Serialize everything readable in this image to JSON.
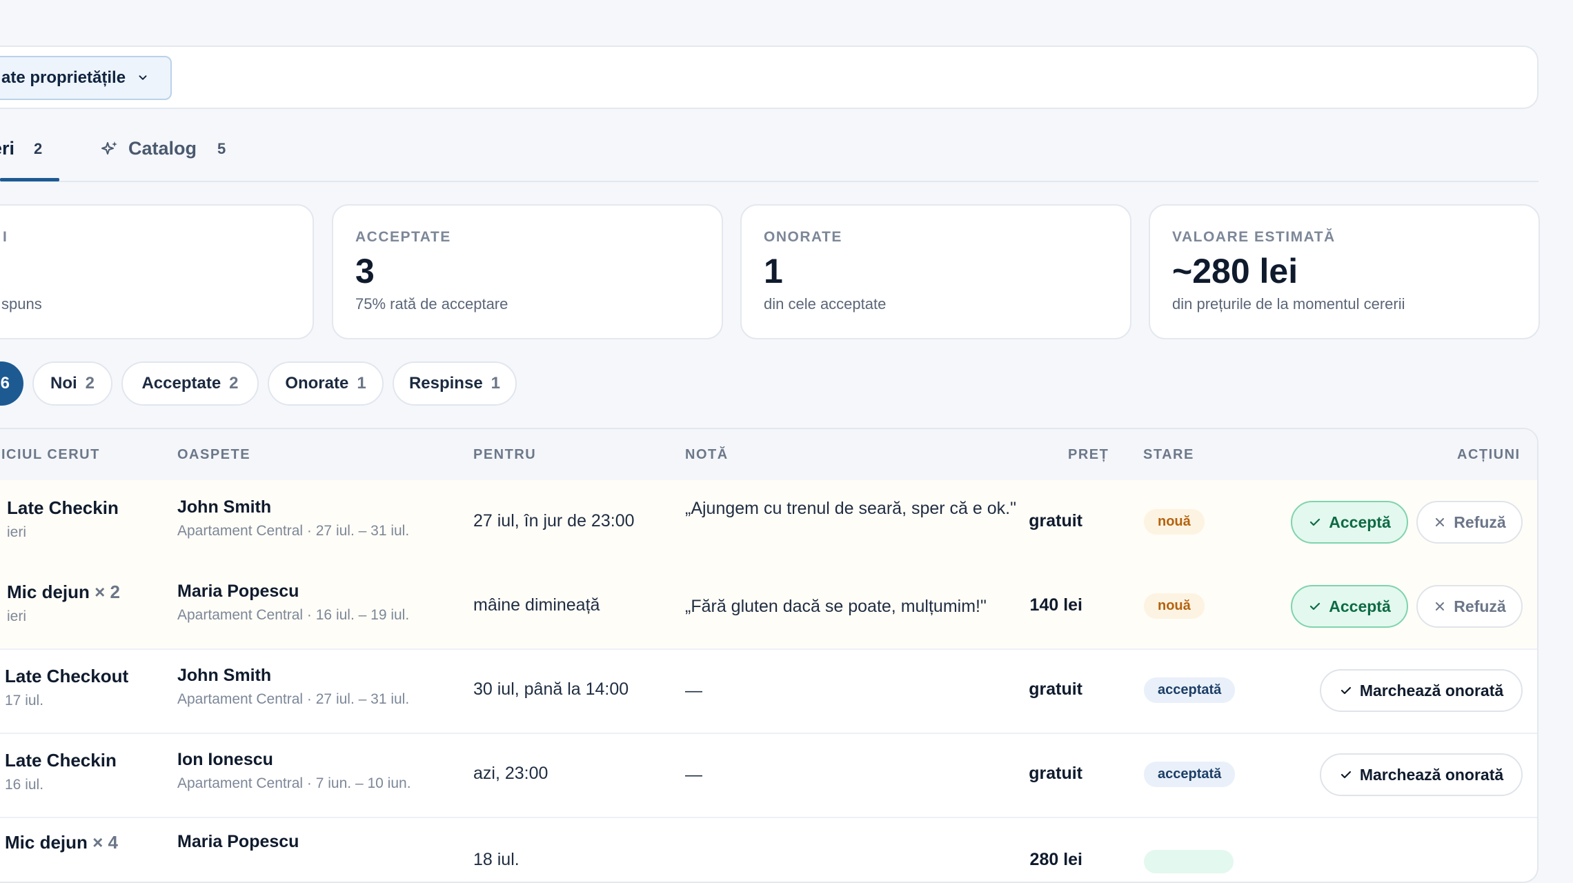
{
  "filter": {
    "property_select": "ate proprietățile"
  },
  "tabs": [
    {
      "label": "eri",
      "count": "2"
    },
    {
      "label": "Catalog",
      "count": "5"
    }
  ],
  "stats": [
    {
      "label": "I",
      "value": "",
      "sub": "spuns"
    },
    {
      "label": "ACCEPTATE",
      "value": "3",
      "sub": "75% rată de acceptare"
    },
    {
      "label": "ONORATE",
      "value": "1",
      "sub": "din cele acceptate"
    },
    {
      "label": "VALOARE ESTIMATĂ",
      "value": "~280 lei",
      "sub": "din prețurile de la momentul cererii"
    }
  ],
  "chips": {
    "active": "6",
    "items": [
      {
        "label": "Noi",
        "count": "2"
      },
      {
        "label": "Acceptate",
        "count": "2"
      },
      {
        "label": "Onorate",
        "count": "1"
      },
      {
        "label": "Respinse",
        "count": "1"
      }
    ]
  },
  "table": {
    "headers": {
      "service": "ICIUL CERUT",
      "guest": "OASPETE",
      "for": "PENTRU",
      "note": "NOTĂ",
      "price": "PREȚ",
      "status": "STARE",
      "actions": "ACȚIUNI"
    },
    "rows": [
      {
        "service": "Late Checkin",
        "qty": "",
        "service_sub": "ieri",
        "guest": "John Smith",
        "guest_sub": "Apartament Central · 27 iul. – 31 iul.",
        "for": "27 iul, în jur de 23:00",
        "note": "„Ajungem cu trenul de seară, sper că e ok.\"",
        "price": "gratuit",
        "status": "nouă"
      },
      {
        "service": "Mic dejun",
        "qty": "× 2",
        "service_sub": "ieri",
        "guest": "Maria Popescu",
        "guest_sub": "Apartament Central · 16 iul. – 19 iul.",
        "for": "mâine dimineață",
        "note": "„Fără gluten dacă se poate, mulțumim!\"",
        "price": "140 lei",
        "status": "nouă"
      },
      {
        "service": "Late Checkout",
        "qty": "",
        "service_sub": "17 iul.",
        "guest": "John Smith",
        "guest_sub": "Apartament Central · 27 iul. – 31 iul.",
        "for": "30 iul, până la 14:00",
        "note": "—",
        "price": "gratuit",
        "status": "acceptată"
      },
      {
        "service": "Late Checkin",
        "qty": "",
        "service_sub": "16 iul.",
        "guest": "Ion Ionescu",
        "guest_sub": "Apartament Central · 7 iun. – 10 iun.",
        "for": "azi, 23:00",
        "note": "—",
        "price": "gratuit",
        "status": "acceptată"
      },
      {
        "service": "Mic dejun",
        "qty": "× 4",
        "service_sub": "",
        "guest": "Maria Popescu",
        "guest_sub": "",
        "for": "18 iul.",
        "note": "",
        "price": "280 lei",
        "status": ""
      }
    ],
    "actions": {
      "accept": "Acceptă",
      "refuse": "Refuză",
      "honor": "Marchează onorată"
    }
  }
}
